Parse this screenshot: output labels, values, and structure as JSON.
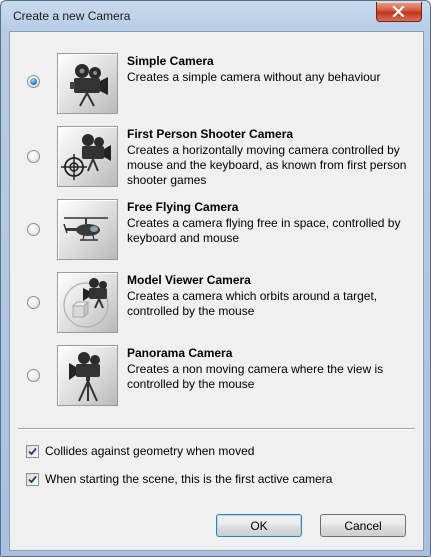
{
  "window": {
    "title": "Create a new Camera"
  },
  "options": [
    {
      "title": "Simple Camera",
      "description": "Creates a simple camera without any behaviour",
      "icon": "camera-icon",
      "selected": true
    },
    {
      "title": "First Person Shooter Camera",
      "description": "Creates a horizontally moving camera controlled by mouse and the keyboard, as known from first person shooter games",
      "icon": "camera-crosshair-icon",
      "selected": false
    },
    {
      "title": "Free Flying Camera",
      "description": "Creates a camera flying free in space, controlled by keyboard and mouse",
      "icon": "helicopter-icon",
      "selected": false
    },
    {
      "title": "Model Viewer Camera",
      "description": "Creates a camera which orbits around a target, controlled by the mouse",
      "icon": "camera-orbit-icon",
      "selected": false
    },
    {
      "title": "Panorama Camera",
      "description": "Creates a non moving camera where the view is controlled by the mouse",
      "icon": "camera-tripod-icon",
      "selected": false
    }
  ],
  "checkboxes": [
    {
      "label": "Collides against geometry when moved",
      "checked": true
    },
    {
      "label": "When starting the scene, this is the first active camera",
      "checked": true
    }
  ],
  "buttons": {
    "ok": "OK",
    "cancel": "Cancel"
  }
}
